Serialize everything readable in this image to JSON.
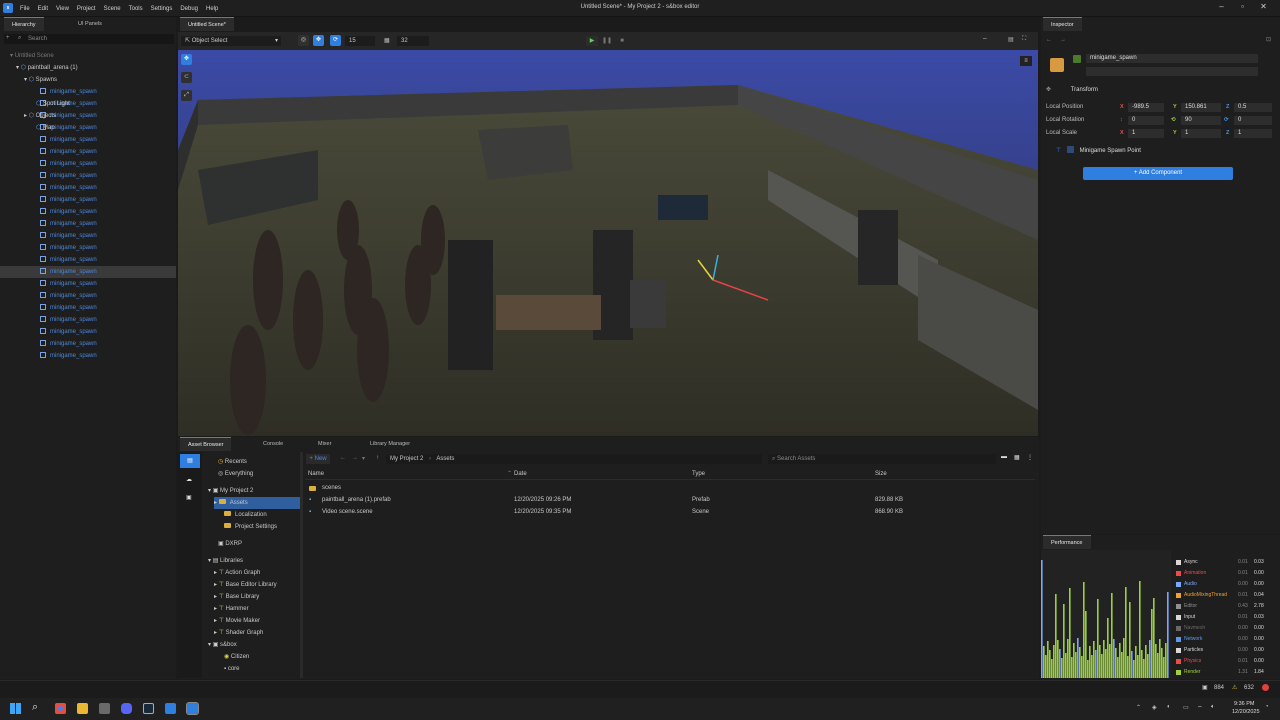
{
  "app": {
    "title": "Untitled Scene* - My Project 2 - s&box editor",
    "logo": "s&box-logo",
    "menu": [
      "File",
      "Edit",
      "View",
      "Project",
      "Scene",
      "Tools",
      "Settings",
      "Debug",
      "Help"
    ]
  },
  "hierarchy": {
    "tabs": [
      "Hierarchy",
      "UI Panels"
    ],
    "search_placeholder": "Search",
    "root": "Untitled Scene",
    "arena": "paintball_arena (1)",
    "spawns": "Spawns",
    "spawn_items": [
      "minigame_spawn",
      "minigame_spawn",
      "minigame_spawn",
      "minigame_spawn",
      "minigame_spawn",
      "minigame_spawn",
      "minigame_spawn",
      "minigame_spawn",
      "minigame_spawn",
      "minigame_spawn",
      "minigame_spawn",
      "minigame_spawn",
      "minigame_spawn",
      "minigame_spawn",
      "minigame_spawn",
      "minigame_spawn",
      "minigame_spawn",
      "minigame_spawn",
      "minigame_spawn",
      "minigame_spawn",
      "minigame_spawn",
      "minigame_spawn",
      "minigame_spawn"
    ],
    "selected_index": 15,
    "after": [
      "Spot Light",
      "Objects",
      "Map"
    ]
  },
  "viewport": {
    "tab": "Untitled Scene*",
    "mode": "Object Select",
    "grid_snap": "15",
    "grid_size": "32"
  },
  "bottom": {
    "tabs": [
      "Asset Browser",
      "Console",
      "Mixer",
      "Library Manager"
    ],
    "new_label": "New",
    "path": [
      "My Project 2",
      "Assets"
    ],
    "search_placeholder": "Search Assets",
    "sidebar": {
      "recents": "Recents",
      "everything": "Everything",
      "project": "My Project 2",
      "assets": "Assets",
      "localization": "Localization",
      "project_settings": "Project Settings",
      "dxrp": "DXRP",
      "libraries": "Libraries",
      "libs": [
        "Action Graph",
        "Base Editor Library",
        "Base Library",
        "Hammer",
        "Movie Maker",
        "Shader Graph"
      ],
      "sbox": "s&box",
      "citizen": "Citizen",
      "core": "core"
    },
    "columns": [
      "Name",
      "Date",
      "Type",
      "Size"
    ],
    "files": [
      {
        "name": "scenes",
        "date": "",
        "type": "",
        "size": ""
      },
      {
        "name": "paintball_arena (1).prefab",
        "date": "12/20/2025 09:26 PM",
        "type": "Prefab",
        "size": "829.88 KB"
      },
      {
        "name": "Video scene.scene",
        "date": "12/20/2025 09:35 PM",
        "type": "Scene",
        "size": "868.90 KB"
      }
    ]
  },
  "inspector": {
    "tab": "Inspector",
    "object_name": "minigame_spawn",
    "transform": "Transform",
    "local_position": "Local Position",
    "local_rotation": "Local Rotation",
    "local_scale": "Local Scale",
    "pos": [
      "-989.5",
      "150.861",
      "0.5"
    ],
    "rot": [
      "0",
      "90",
      "0"
    ],
    "scale": [
      "1",
      "1",
      "1"
    ],
    "component": "Minigame Spawn Point",
    "add_component": "Add Component"
  },
  "performance": {
    "tab": "Performance",
    "rows": [
      {
        "name": "Async",
        "a": "0.01",
        "b": "0.03",
        "color": "#d8d8d8"
      },
      {
        "name": "Animation",
        "a": "0.01",
        "b": "0.00",
        "color": "#e84c4c"
      },
      {
        "name": "Audio",
        "a": "0.00",
        "b": "0.00",
        "color": "#7aa8ff"
      },
      {
        "name": "AudioMixingThread",
        "a": "0.01",
        "b": "0.04",
        "color": "#f0a030"
      },
      {
        "name": "Editor",
        "a": "0.43",
        "b": "2.78",
        "color": "#909090"
      },
      {
        "name": "Input",
        "a": "0.01",
        "b": "0.03",
        "color": "#d8d8d8"
      },
      {
        "name": "Navmesh",
        "a": "0.00",
        "b": "0.00",
        "color": "#6a6a6a"
      },
      {
        "name": "Network",
        "a": "0.00",
        "b": "0.00",
        "color": "#5a9ae8"
      },
      {
        "name": "Particles",
        "a": "0.00",
        "b": "0.00",
        "color": "#d8d8d8"
      },
      {
        "name": "Physics",
        "a": "0.01",
        "b": "0.00",
        "color": "#e84c4c"
      },
      {
        "name": "Render",
        "a": "1.31",
        "b": "1.84",
        "color": "#a0d040"
      }
    ]
  },
  "status": {
    "count1": "884",
    "count2": "632"
  },
  "taskbar": {
    "time": "9:36 PM",
    "date": "12/20/2025"
  }
}
